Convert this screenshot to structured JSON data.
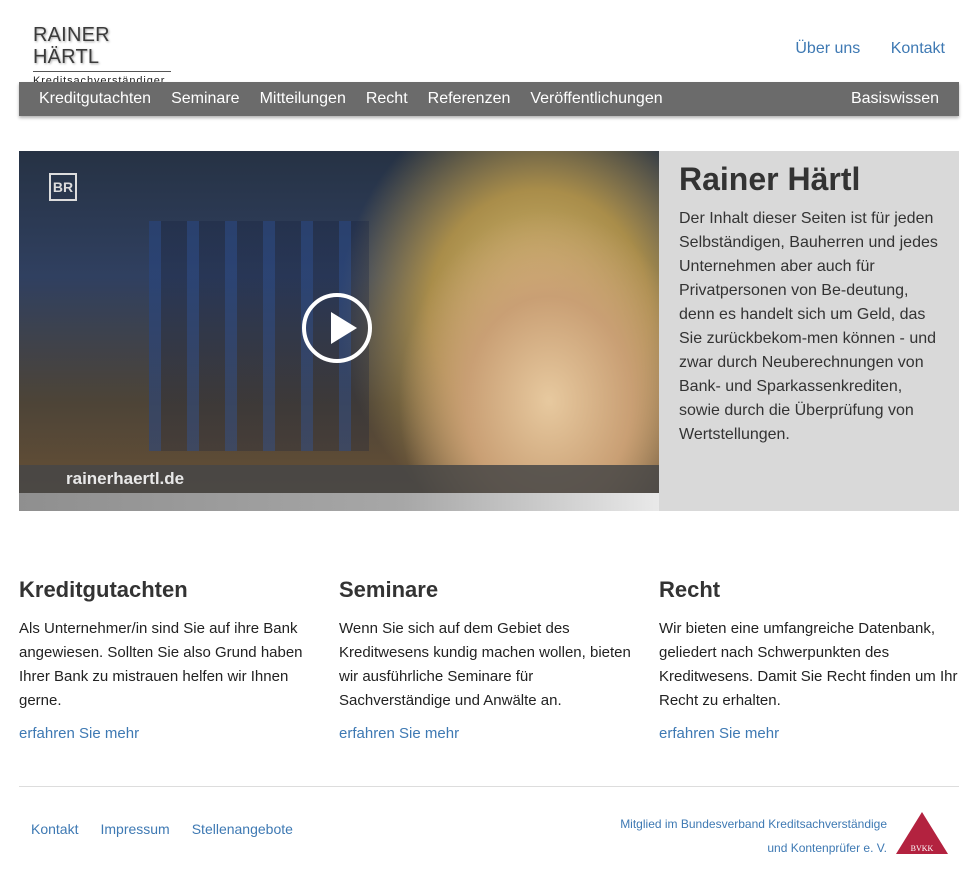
{
  "header": {
    "logo_title": "RAINER HÄRTL",
    "logo_subtitle": "Kreditsachverständiger",
    "top_links": [
      "Über uns",
      "Kontakt"
    ]
  },
  "nav": {
    "items": [
      "Kreditgutachten",
      "Seminare",
      "Mitteilungen",
      "Recht",
      "Referenzen",
      "Veröffentlichungen"
    ],
    "right_item": "Basiswissen"
  },
  "hero": {
    "video_caption": "rainerhaertl.de",
    "video_logo": "BR",
    "title": "Rainer Härtl",
    "text": "Der Inhalt dieser Seiten ist für jeden Selbständigen, Bauherren und jedes Unternehmen aber auch für Privatpersonen von Be-deutung, denn es handelt sich um Geld, das Sie zurückbekom-men können - und zwar durch Neuberechnungen von Bank- und Sparkassenkrediten, sowie durch die Überprüfung von Wertstellungen."
  },
  "columns": [
    {
      "title": "Kreditgutachten",
      "text": "Als Unternehmer/in sind Sie auf ihre Bank angewiesen. Sollten Sie also Grund haben Ihrer Bank zu mistrauen helfen wir Ihnen gerne.",
      "link": "erfahren Sie mehr"
    },
    {
      "title": "Seminare",
      "text": "Wenn Sie sich auf dem Gebiet des Kreditwesens kundig machen wollen, bieten wir ausführliche Seminare für Sachverständige und Anwälte an.",
      "link": "erfahren Sie mehr"
    },
    {
      "title": "Recht",
      "text": "Wir bieten eine umfangreiche Datenbank, geliedert nach Schwerpunkten des Kreditwesens. Damit Sie Recht finden um Ihr Recht zu erhalten.",
      "link": "erfahren Sie mehr"
    }
  ],
  "footer": {
    "links": [
      "Kontakt",
      "Impressum",
      "Stellenangebote"
    ],
    "member_line1": "Mitglied im Bundesverband Kreditsachverständige",
    "member_line2": "und Kontenprüfer e. V.",
    "badge_text": "BVKK",
    "badge_color": "#b3223f"
  }
}
